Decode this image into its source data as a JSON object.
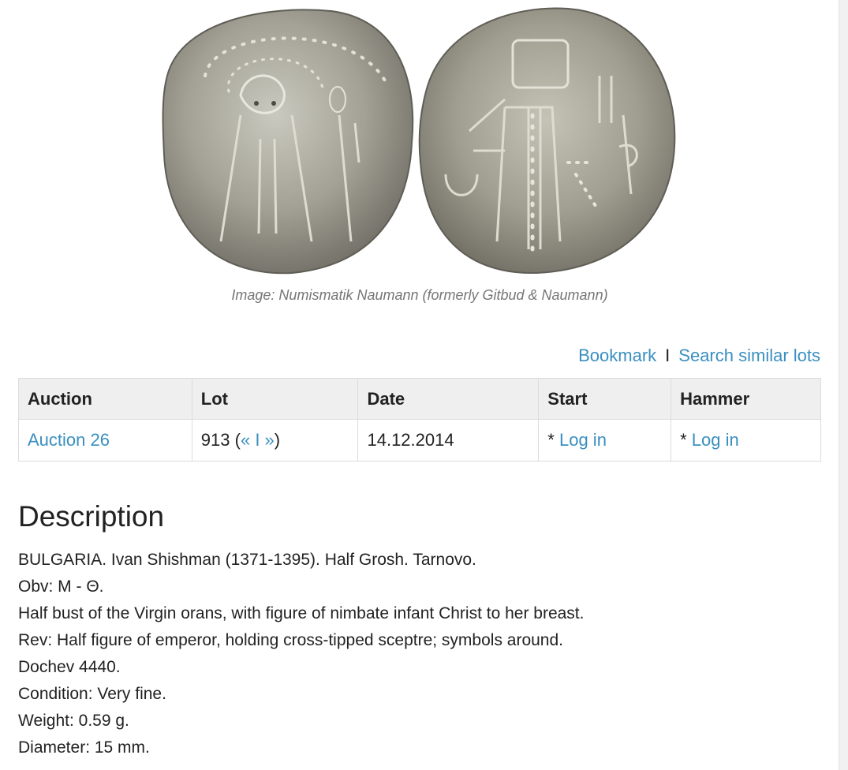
{
  "image": {
    "caption": "Image: Numismatik Naumann (formerly Gitbud & Naumann)"
  },
  "actions": {
    "bookmark": "Bookmark",
    "separator": "I",
    "search_similar": "Search similar lots"
  },
  "table": {
    "headers": [
      "Auction",
      "Lot",
      "Date",
      "Start",
      "Hammer"
    ],
    "row": {
      "auction": "Auction 26",
      "lot_number": "913",
      "lot_open": " (",
      "lot_prev": "«",
      "lot_sep": " I ",
      "lot_next": "»",
      "lot_close": ")",
      "date": "14.12.2014",
      "start_prefix": "* ",
      "start_link": "Log in",
      "hammer_prefix": "* ",
      "hammer_link": "Log in"
    }
  },
  "description": {
    "title": "Description",
    "lines": [
      "BULGARIA. Ivan Shishman (1371-1395). Half Grosh. Tarnovo.",
      "Obv: M - Θ.",
      "Half bust of the Virgin orans, with figure of nimbate infant Christ to her breast.",
      "Rev: Half figure of emperor, holding cross-tipped sceptre; symbols around.",
      "Dochev 4440.",
      "Condition: Very fine.",
      "Weight: 0.59 g.",
      "Diameter: 15 mm."
    ]
  },
  "colors": {
    "link": "#3a8fc0",
    "header_bg": "#efefef",
    "caption": "#767676"
  }
}
